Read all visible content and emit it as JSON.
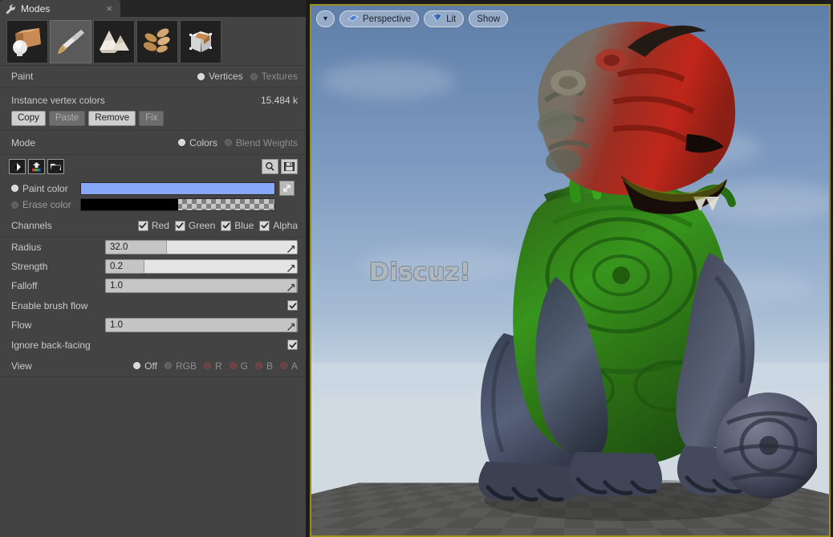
{
  "tab": {
    "label": "Modes",
    "icon": "wrench-icon",
    "close_label": "×"
  },
  "modes": [
    {
      "id": "place",
      "label": "Place",
      "icon": "place-mode-icon",
      "selected": false
    },
    {
      "id": "paint",
      "label": "Paint",
      "icon": "paint-brush-icon",
      "selected": true
    },
    {
      "id": "landscape",
      "label": "Landscape",
      "icon": "landscape-icon",
      "selected": false
    },
    {
      "id": "foliage",
      "label": "Foliage",
      "icon": "foliage-leaf-icon",
      "selected": false
    },
    {
      "id": "geometry",
      "label": "Geometry Editing",
      "icon": "geometry-box-icon",
      "selected": false
    }
  ],
  "paint_section": {
    "title": "Paint",
    "targets": [
      {
        "label": "Vertices",
        "selected": true
      },
      {
        "label": "Textures",
        "selected": false
      }
    ]
  },
  "instance_vertex_colors": {
    "title": "Instance vertex colors",
    "count": "15.484 k",
    "buttons": [
      {
        "label": "Copy",
        "enabled": true
      },
      {
        "label": "Paste",
        "enabled": false
      },
      {
        "label": "Remove",
        "enabled": true
      },
      {
        "label": "Fix",
        "enabled": false
      }
    ]
  },
  "mode_section": {
    "title": "Mode",
    "options": [
      {
        "label": "Colors",
        "selected": true
      },
      {
        "label": "Blend Weights",
        "selected": false
      }
    ]
  },
  "color_tools": {
    "left_icons": [
      {
        "name": "fill-bucket-icon",
        "title": "Fill"
      },
      {
        "name": "import-color-icon",
        "title": "Import vertex colors"
      },
      {
        "name": "open-folder-icon",
        "title": "Open"
      }
    ],
    "right_icons": [
      {
        "name": "magnifier-icon",
        "title": "Preview"
      },
      {
        "name": "save-disk-icon",
        "title": "Save"
      }
    ]
  },
  "colors": {
    "paint": {
      "label": "Paint color",
      "value": "#88a6fa",
      "selected": true
    },
    "erase": {
      "label": "Erase color",
      "value": "#000000",
      "selected": false
    },
    "swap_icon": "swap-colors-icon"
  },
  "channels": {
    "label": "Channels",
    "items": [
      {
        "label": "Red",
        "checked": true
      },
      {
        "label": "Green",
        "checked": true
      },
      {
        "label": "Blue",
        "checked": true
      },
      {
        "label": "Alpha",
        "checked": true
      }
    ]
  },
  "params": [
    {
      "label": "Radius",
      "value": "32.0",
      "fill_pct": 32
    },
    {
      "label": "Strength",
      "value": "0.2",
      "fill_pct": 20
    },
    {
      "label": "Falloff",
      "value": "1.0",
      "fill_pct": 100
    }
  ],
  "toggles": {
    "enable_brush_flow": {
      "label": "Enable brush flow",
      "checked": true
    },
    "ignore_back_facing": {
      "label": "Ignore back-facing",
      "checked": true
    }
  },
  "flow": {
    "label": "Flow",
    "value": "1.0",
    "fill_pct": 100
  },
  "view": {
    "label": "View",
    "options": [
      {
        "label": "Off",
        "selected": true,
        "kind": "plain"
      },
      {
        "label": "RGB",
        "selected": false,
        "kind": "plain"
      },
      {
        "label": "R",
        "selected": false,
        "kind": "r"
      },
      {
        "label": "G",
        "selected": false,
        "kind": "g"
      },
      {
        "label": "B",
        "selected": false,
        "kind": "b"
      },
      {
        "label": "A",
        "selected": false,
        "kind": "a"
      }
    ]
  },
  "viewport": {
    "border_color": "#9a8f1e",
    "toolbar": {
      "menu_label": "▾",
      "camera": {
        "label": "Perspective",
        "icon": "camera-perspective-icon"
      },
      "lighting": {
        "label": "Lit",
        "icon": "lit-shading-icon"
      },
      "show": {
        "label": "Show"
      }
    },
    "watermark": "Discuz!",
    "scene": {
      "object": "vertex-painted-creature",
      "sky_color": "#7d9ac0",
      "ground_color": "#5a5a58"
    }
  }
}
